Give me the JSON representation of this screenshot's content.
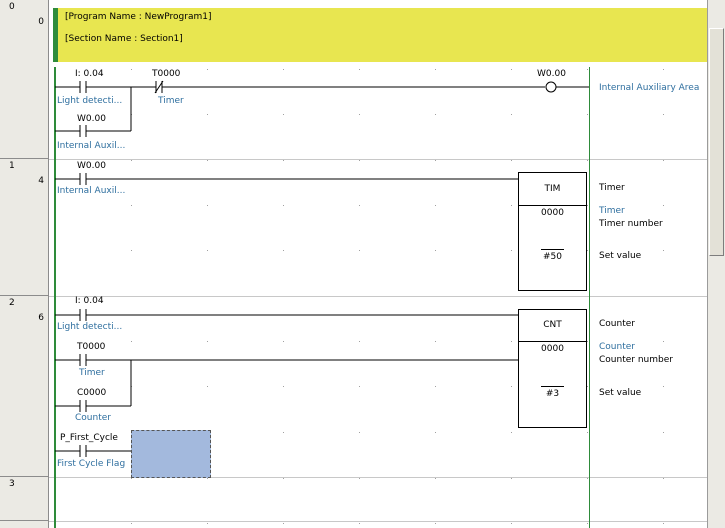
{
  "gutter": {
    "rungs": [
      {
        "rung": "0",
        "step": "0"
      },
      {
        "rung": "1",
        "step": "4"
      },
      {
        "rung": "2",
        "step": "6"
      },
      {
        "rung": "3",
        "step": ""
      }
    ]
  },
  "header": {
    "program_name": "[Program Name : NewProgram1]",
    "section_name": "[Section Name : Section1]"
  },
  "rung0": {
    "c1_addr": "I: 0.04",
    "c1_comment": "Light detecti...",
    "c2_addr": "T0000",
    "c2_comment": "Timer",
    "c3_addr": "W0.00",
    "c3_comment": "Internal Auxil...",
    "coil_addr": "W0.00",
    "coil_comment": "Internal Auxiliary Area"
  },
  "rung1": {
    "c1_addr": "W0.00",
    "c1_comment": "Internal Auxil...",
    "box_name": "TIM",
    "box_op1": "0000",
    "box_op2": "#50",
    "right_title": "Timer",
    "right_op1_comment": "Timer",
    "right_op1_desc": "Timer number",
    "right_op2_desc": "Set value"
  },
  "rung2": {
    "c1_addr": "I: 0.04",
    "c1_comment": "Light detecti...",
    "c2_addr": "T0000",
    "c2_comment": "Timer",
    "c3_addr": "C0000",
    "c3_comment": "Counter",
    "c4_addr": "P_First_Cycle",
    "c4_comment": "First Cycle Flag",
    "box_name": "CNT",
    "box_op1": "0000",
    "box_op2": "#3",
    "right_title": "Counter",
    "right_op1_comment": "Counter",
    "right_op1_desc": "Counter number",
    "right_op2_desc": "Set value"
  },
  "colors": {
    "header_bg": "#e8e650",
    "bus_green": "#2e8b3a",
    "comment_blue": "#2f6f9f",
    "selection": "#a3b9dd"
  }
}
